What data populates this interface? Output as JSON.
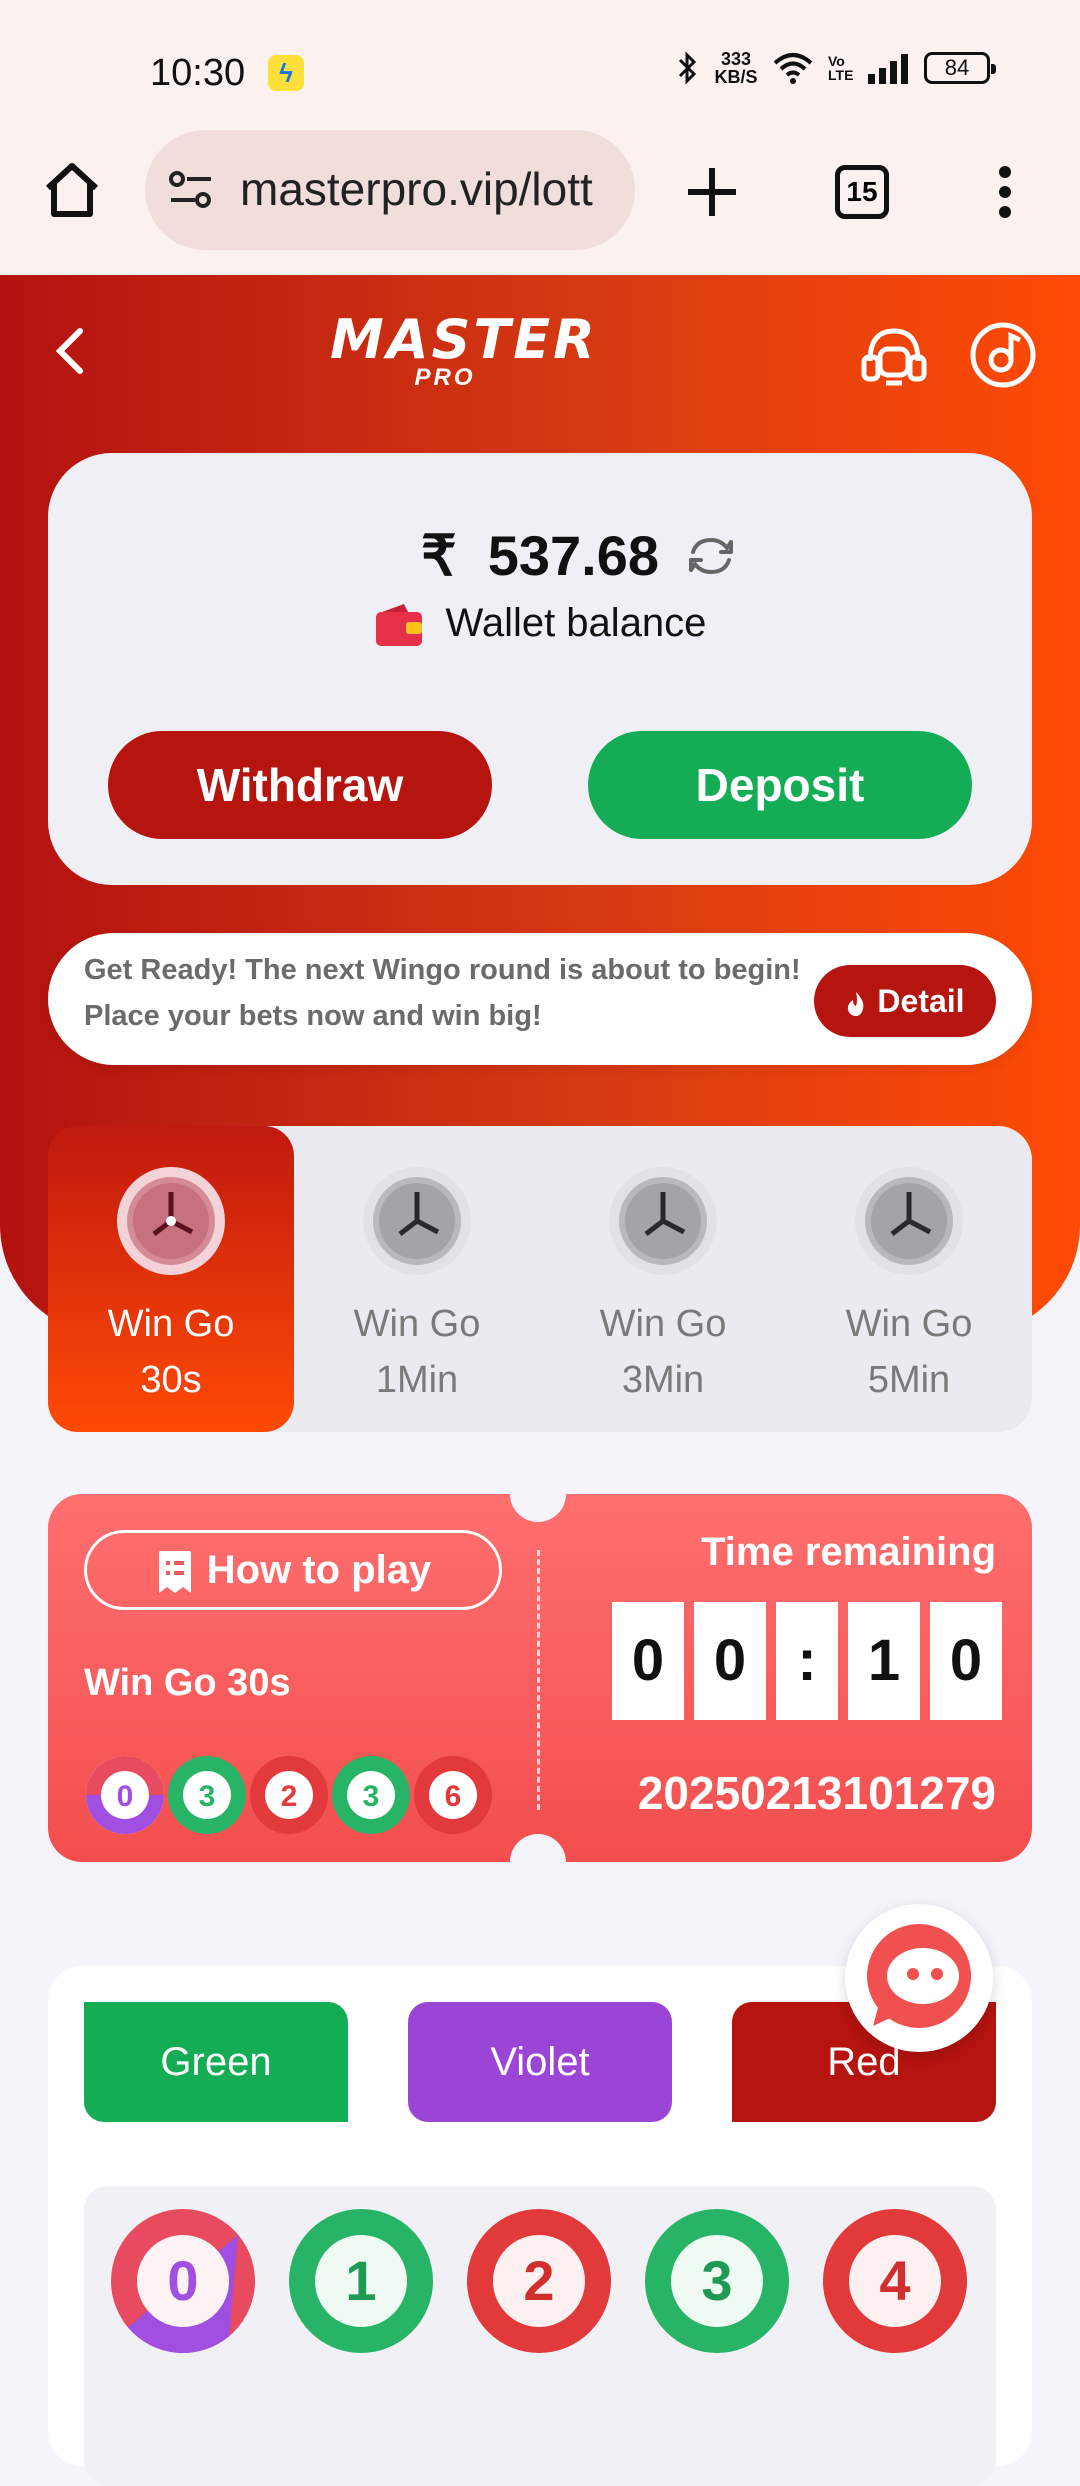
{
  "status_bar": {
    "time": "10:30",
    "net_speed": "333 KB/S",
    "battery": "84",
    "volte": "Vo LTE"
  },
  "browser": {
    "url": "masterpro.vip/lott",
    "tab_count": "15"
  },
  "header": {
    "logo_main": "MASTER",
    "logo_sub": "PRO"
  },
  "wallet": {
    "currency": "₹",
    "amount": "537.68",
    "label": "Wallet balance",
    "withdraw_label": "Withdraw",
    "deposit_label": "Deposit"
  },
  "notice": {
    "text": "Get Ready! The next Wingo round is about to begin! Place your bets now and win big!",
    "detail_label": "Detail"
  },
  "game_tabs": [
    {
      "line1": "Win Go",
      "line2": "30s",
      "active": true
    },
    {
      "line1": "Win Go",
      "line2": "1Min",
      "active": false
    },
    {
      "line1": "Win Go",
      "line2": "3Min",
      "active": false
    },
    {
      "line1": "Win Go",
      "line2": "5Min",
      "active": false
    }
  ],
  "round": {
    "how_to_play": "How to play",
    "game_name": "Win Go 30s",
    "recent_results": [
      "0",
      "3",
      "2",
      "3",
      "6"
    ],
    "time_label": "Time remaining",
    "digits": [
      "0",
      "0",
      ":",
      "1",
      "0"
    ],
    "period": "20250213101279"
  },
  "bet": {
    "green_label": "Green",
    "violet_label": "Violet",
    "red_label": "Red",
    "numbers": [
      "0",
      "1",
      "2",
      "3",
      "4"
    ]
  },
  "colors": {
    "red": "#b5140f",
    "green": "#14ad55",
    "violet": "#9b45d6",
    "accent_orange": "#ff4a05"
  }
}
